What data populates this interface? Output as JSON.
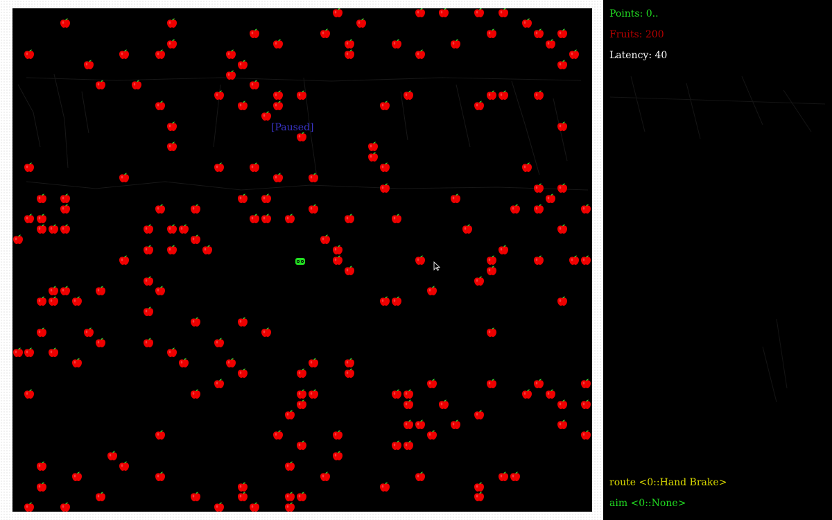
{
  "hud": {
    "points_label": "Points: 0..",
    "fruits_label": "Fruits: 200",
    "latency_label": "Latency: 40",
    "route_label": "route <0::Hand Brake>",
    "aim_label": "aim  <0::None>"
  },
  "board": {
    "status_label": "[Paused]"
  },
  "colors": {
    "board_bg": "#000000",
    "points": "#22dd22",
    "fruits": "#b80000",
    "latency": "#ffffff",
    "paused": "#3a35c8",
    "route": "#d8d800",
    "aim": "#22dd22",
    "apple": "#ee0000",
    "leaf": "#33cc33",
    "snake": "#22dd22"
  },
  "icons": {
    "fruit": "apple-icon",
    "player": "snake-head-icon",
    "pointer": "mouse-cursor-icon"
  }
}
